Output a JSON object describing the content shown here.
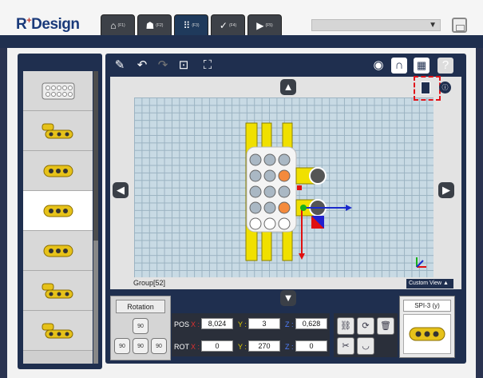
{
  "app": {
    "logo_main": "R",
    "logo_sup": "+",
    "logo_suffix": "Design"
  },
  "tabs": [
    {
      "icon": "home-icon",
      "glyph": "⌂",
      "label": "(F1)"
    },
    {
      "icon": "user-icon",
      "glyph": "☗",
      "label": "(F2)"
    },
    {
      "icon": "grid-dots-icon",
      "glyph": "⠿",
      "label": "(F3)"
    },
    {
      "icon": "check-icon",
      "glyph": "✓",
      "label": "(F4)"
    },
    {
      "icon": "play-icon",
      "glyph": "▶",
      "label": "(F5)"
    }
  ],
  "active_tab": 2,
  "top_select": {
    "value": ""
  },
  "toolbar": {
    "left_icons": [
      "add-part-icon",
      "undo-icon",
      "redo-icon",
      "center-view-icon",
      "fit-view-icon"
    ],
    "right_icons": [
      "eye-icon",
      "magnet-icon",
      "grid-toggle-icon",
      "help-icon"
    ]
  },
  "viewport": {
    "group_label": "Group[52]",
    "custom_view_label": "Custom View ▲"
  },
  "rotation": {
    "button_label": "Rotation",
    "top_label": "90",
    "left_label": "90",
    "mid_label": "90",
    "right_label": "90"
  },
  "pos": {
    "label": "POS",
    "x_label": "X :",
    "x": "8,024",
    "y_label": "Y :",
    "y": "3",
    "z_label": "Z :",
    "z": "0,628"
  },
  "rot": {
    "label": "ROT",
    "x_label": "X :",
    "x": "0",
    "y_label": "Y :",
    "y": "270",
    "z_label": "Z :",
    "z": "0"
  },
  "actions": [
    "link-icon",
    "swap-icon",
    "trash-icon",
    "wrench-icon",
    "hide-icon"
  ],
  "preview": {
    "title": "SPI-3 (y)"
  },
  "colors": {
    "panel": "#1f2f4f",
    "grid": "#c8dae4",
    "accent": "#e0141a"
  }
}
